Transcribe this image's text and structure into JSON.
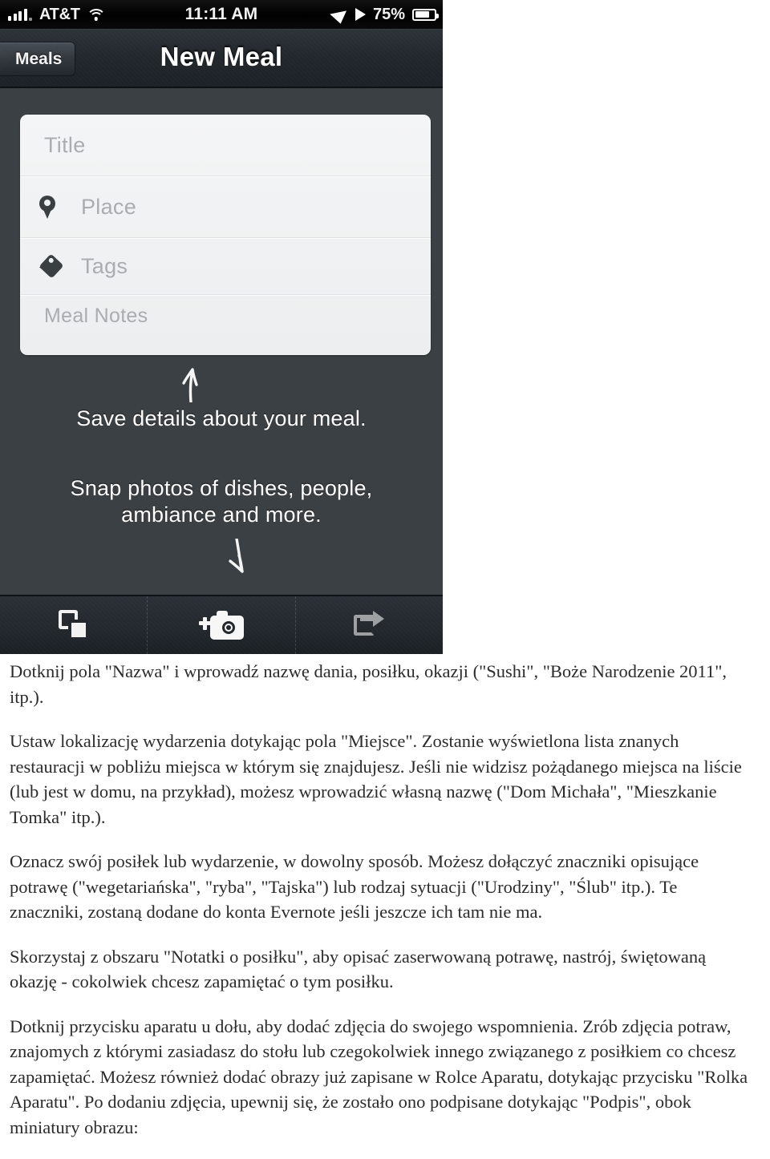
{
  "phone": {
    "status_bar": {
      "carrier": "AT&T",
      "time": "11:11 AM",
      "battery_percent": "75%",
      "icons": [
        "signal-bars-icon",
        "wifi-icon",
        "location-arrow-icon",
        "play-icon",
        "battery-icon"
      ]
    },
    "nav_bar": {
      "back_label": "Meals",
      "title": "New Meal"
    },
    "form": {
      "title_placeholder": "Title",
      "place_placeholder": "Place",
      "tags_placeholder": "Tags",
      "notes_placeholder": "Meal Notes"
    },
    "hints": {
      "line_1": "Save details about your meal.",
      "line_2a": "Snap photos of dishes, people,",
      "line_2b": "ambiance and more."
    },
    "toolbar": {
      "photos_label": "photos-icon",
      "camera_label": "camera-add-icon",
      "share_label": "share-icon"
    }
  },
  "article": {
    "p1": "Dotknij pola \"Nazwa\" i wprowadź nazwę dania, posiłku, okazji (\"Sushi\", \"Boże Narodzenie 2011\", itp.).",
    "p2": "Ustaw lokalizację wydarzenia dotykając pola \"Miejsce\". Zostanie wyświetlona lista znanych restauracji w pobliżu miejsca w którym się znajdujesz. Jeśli nie widzisz pożądanego miejsca na liście (lub jest w domu, na przykład), możesz wprowadzić własną nazwę (\"Dom Michała\", \"Mieszkanie Tomka\" itp.).",
    "p3": "Oznacz swój posiłek lub wydarzenie, w dowolny sposób. Możesz dołączyć znaczniki opisujące potrawę (\"wegetariańska\", \"ryba\", \"Tajska\") lub rodzaj sytuacji (\"Urodziny\", \"Ślub\" itp.). Te znaczniki, zostaną dodane do konta Evernote jeśli jeszcze ich tam nie ma.",
    "p4": "Skorzystaj z obszaru \"Notatki o posiłku\", aby opisać zaserwowaną potrawę, nastrój, świętowaną okazję - cokolwiek chcesz zapamiętać o tym posiłku.",
    "p5": "Dotknij przycisku aparatu u dołu, aby dodać zdjęcia do swojego wspomnienia. Zrób zdjęcia potraw, znajomych z którymi zasiadasz do stołu lub czegokolwiek innego związanego z posiłkiem co chcesz zapamiętać. Możesz również dodać obrazy już zapisane w Rolce Aparatu, dotykając przycisku \"Rolka Aparatu\". Po dodaniu zdjęcia, upewnij się, że zostało ono podpisane dotykając \"Podpis\", obok miniatury obrazu:"
  },
  "colors": {
    "screen_bg": "#3b4044",
    "nav_bar": "#252a30",
    "status_bar": "#000000",
    "card_bg": "#eef0f1",
    "placeholder": "#a9adb0",
    "hint_text": "#ffffff",
    "article_text": "#2b2b2b"
  }
}
